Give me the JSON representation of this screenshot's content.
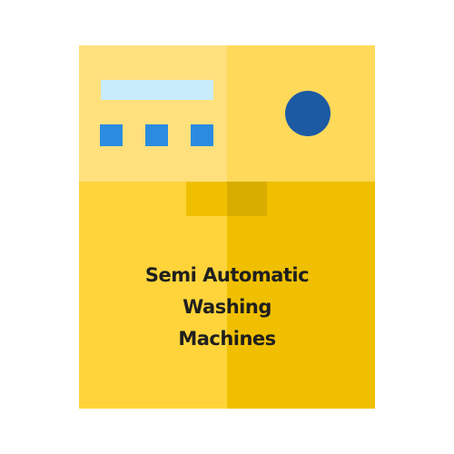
{
  "product": {
    "icon": "washing-machine-icon",
    "caption_lines": [
      "Semi Automatic",
      "Washing",
      "Machines"
    ]
  },
  "colors": {
    "panel_left": "#ffe07d",
    "panel_right": "#ffd95a",
    "body_left": "#ffd43b",
    "body_right": "#f0c000",
    "display": "#c9ecfb",
    "buttons": "#2b8be0",
    "knob": "#1c5aa3",
    "handle_left": "#f0c000",
    "handle_right": "#d8ad00"
  }
}
